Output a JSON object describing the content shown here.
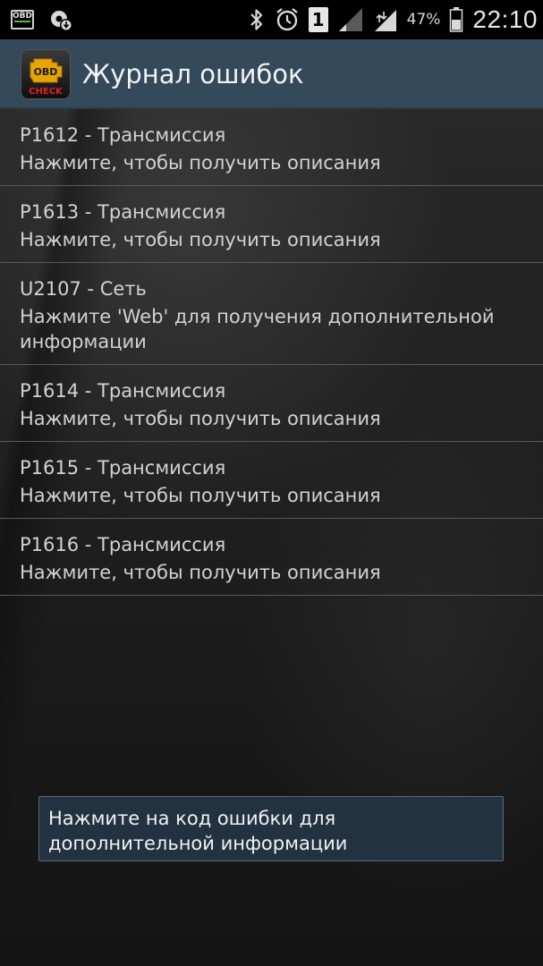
{
  "status_bar": {
    "notification_obd_label": "OBD",
    "battery_percent": "47%",
    "sim_slot": "1",
    "time": "22:10",
    "icons": [
      "obd-notification-icon",
      "settings-download-icon",
      "bluetooth-icon",
      "alarm-icon",
      "sim-signal-icon",
      "signal-icon",
      "battery-icon"
    ]
  },
  "action_bar": {
    "app_icon_top": "OBD",
    "app_icon_bottom": "CHECK",
    "title": "Журнал ошибок",
    "color": "#34495a"
  },
  "errors": [
    {
      "code": "P1612 - Трансмиссия",
      "description": "Нажмите, чтобы получить описания"
    },
    {
      "code": "P1613 - Трансмиссия",
      "description": "Нажмите, чтобы получить описания"
    },
    {
      "code": "U2107 - Сеть",
      "description": "Нажмите 'Web' для получения дополнительной информации"
    },
    {
      "code": "P1614 - Трансмиссия",
      "description": "Нажмите, чтобы получить описания"
    },
    {
      "code": "P1615 - Трансмиссия",
      "description": "Нажмите, чтобы получить описания"
    },
    {
      "code": "P1616 - Трансмиссия",
      "description": "Нажмите, чтобы получить описания"
    }
  ],
  "toast": {
    "text": "Нажмите на код ошибки для дополнительной информации"
  }
}
